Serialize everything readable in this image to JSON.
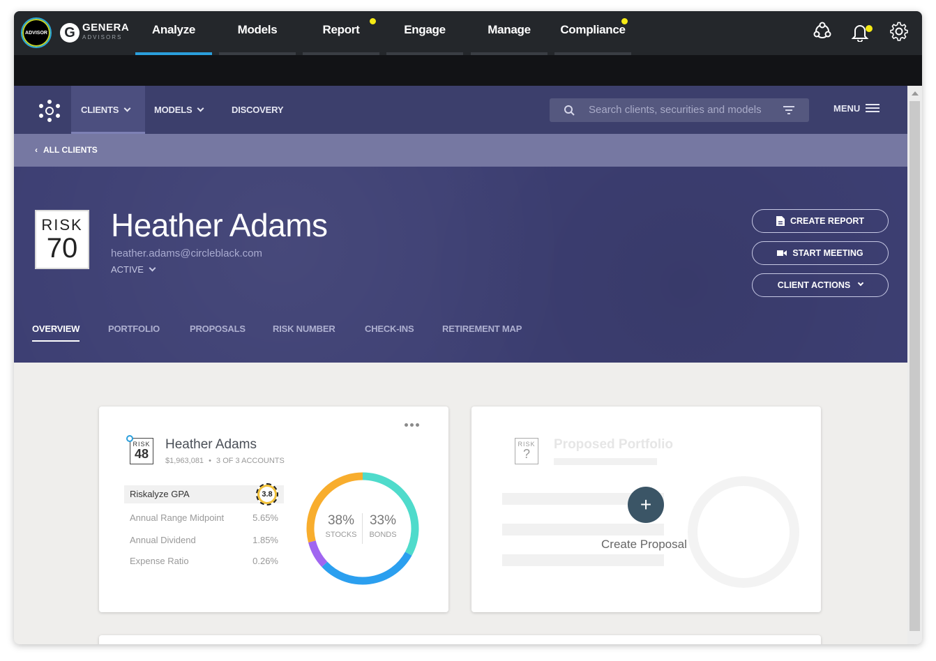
{
  "app": {
    "advisor_badge": "ADVISOR",
    "brand_letter": "G",
    "brand_name": "GENERA",
    "brand_sub": "ADVISORS",
    "accent_color": "#2b9fdc",
    "notification_color": "#f5ea14"
  },
  "top_nav": [
    {
      "label": "Analyze",
      "active": true
    },
    {
      "label": "Models"
    },
    {
      "label": "Report",
      "dot": true
    },
    {
      "label": "Engage"
    },
    {
      "label": "Manage"
    },
    {
      "label": "Compliance",
      "dot": true
    }
  ],
  "top_icons": [
    "community-icon",
    "bell-icon",
    "gear-icon"
  ],
  "sub_nav": {
    "items": [
      {
        "label": "CLIENTS"
      },
      {
        "label": "MODELS"
      },
      {
        "label": "DISCOVERY"
      }
    ],
    "search_placeholder": "Search clients, securities and models",
    "menu_label": "MENU"
  },
  "breadcrumb": {
    "label": "ALL CLIENTS"
  },
  "client": {
    "risk_label": "RISK",
    "risk_number": "70",
    "name": "Heather Adams",
    "email": "heather.adams@circleblack.com",
    "status": "ACTIVE"
  },
  "header_buttons": {
    "create_report": "CREATE REPORT",
    "start_meeting": "START MEETING",
    "client_actions": "CLIENT ACTIONS"
  },
  "tabs": [
    {
      "label": "OVERVIEW",
      "active": true
    },
    {
      "label": "PORTFOLIO"
    },
    {
      "label": "PROPOSALS"
    },
    {
      "label": "RISK NUMBER"
    },
    {
      "label": "CHECK-INS"
    },
    {
      "label": "RETIREMENT MAP"
    }
  ],
  "portfolio_card": {
    "risk_label": "RISK",
    "risk_number": "48",
    "name": "Heather Adams",
    "value": "$1,963,081",
    "separator": "•",
    "accounts": "3 OF 3 ACCOUNTS",
    "gpa_label": "Riskalyze GPA",
    "gpa_value": "3.8",
    "metrics": [
      {
        "label": "Annual Range Midpoint",
        "value": "5.65%"
      },
      {
        "label": "Annual Dividend",
        "value": "1.85%"
      },
      {
        "label": "Expense Ratio",
        "value": "0.26%"
      }
    ],
    "allocation": {
      "stocks_pct": "38%",
      "stocks_label": "STOCKS",
      "bonds_pct": "33%",
      "bonds_label": "BONDS",
      "segments": [
        {
          "color": "#4fdbcb",
          "fraction": 0.33
        },
        {
          "color": "#2b9fef",
          "fraction": 0.3
        },
        {
          "color": "#a066f0",
          "fraction": 0.08
        },
        {
          "color": "#f8ad2d",
          "fraction": 0.29
        }
      ]
    }
  },
  "proposal_card": {
    "risk_label": "RISK",
    "risk_number": "?",
    "title": "Proposed Portfolio",
    "create_label": "Create Proposal",
    "add_symbol": "+"
  }
}
